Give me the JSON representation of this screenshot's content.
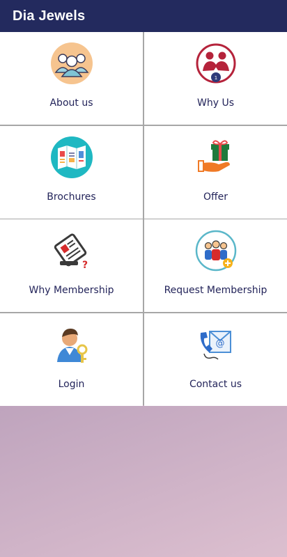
{
  "app_bar": {
    "title": "Dia Jewels",
    "color": "#232a5e"
  },
  "tiles": [
    {
      "label": "About us",
      "icon": "team-icon"
    },
    {
      "label": "Why Us",
      "icon": "handshake-icon"
    },
    {
      "label": "Brochures",
      "icon": "brochure-icon"
    },
    {
      "label": "Offer",
      "icon": "gift-hand-icon"
    },
    {
      "label": "Why Membership",
      "icon": "membership-card-icon"
    },
    {
      "label": "Request Membership",
      "icon": "add-group-icon"
    },
    {
      "label": "Login",
      "icon": "user-key-icon"
    },
    {
      "label": "Contact us",
      "icon": "phone-email-icon"
    }
  ],
  "colors": {
    "tile_label": "#23245a",
    "divider": "#a7a7a7"
  }
}
